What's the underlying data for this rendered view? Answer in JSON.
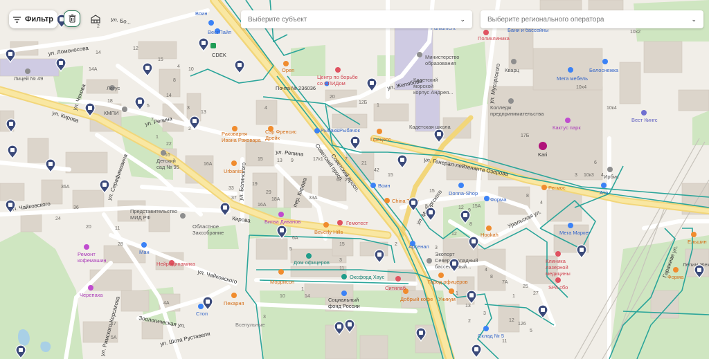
{
  "toolbar": {
    "filter_label": "Фильтр",
    "filter_icon": "filter-lines-icon",
    "trash_icon": "trash-icon",
    "stack_icon": "building-icon"
  },
  "selects": {
    "subject_placeholder": "Выберите субъект",
    "operator_placeholder": "Выберите регионального оператора"
  },
  "colors": {
    "accent": "#2e7d5b",
    "route_teal": "#26a69a",
    "main_road": "#f4d66b",
    "marker": "#3b4a7a",
    "park": "#cfe8c2",
    "building": "#dcd6cc",
    "water": "#b3d4e6"
  },
  "map": {
    "streets": [
      {
        "id": "street-kirova",
        "text": "ул. Кирова"
      },
      {
        "id": "street-kirova-2",
        "text": "Кирова"
      },
      {
        "id": "street-chaikovskogo",
        "text": "ул. Чайковского"
      },
      {
        "id": "street-chaikovskogo-2",
        "text": "ул. Чайковского"
      },
      {
        "id": "street-repina",
        "text": "ул. Репина"
      },
      {
        "id": "street-repina-2",
        "text": "ул. Репина"
      },
      {
        "id": "street-sovetsky",
        "text": "Советский просп."
      },
      {
        "id": "street-sovetsky-2",
        "text": "Советский просп."
      },
      {
        "id": "street-ozerova",
        "text": "ул. Генерал-лейтенанта Озерова"
      },
      {
        "id": "street-zhelyabova",
        "text": "ул. Желябова"
      },
      {
        "id": "street-musorgskogo",
        "text": "ул. Мусоргского"
      },
      {
        "id": "street-musorgskogo-2",
        "text": "ул. Мусоргского"
      },
      {
        "id": "street-uralskaya",
        "text": "Уральская ул."
      },
      {
        "id": "street-garazhnaya",
        "text": "Гаражная ул."
      },
      {
        "id": "street-zoologicheskaya",
        "text": "Зоологическая ул."
      },
      {
        "id": "street-rimskogo",
        "text": "ул. Римского-Корсакова"
      },
      {
        "id": "street-serafimovicha",
        "text": "ул. Серафимовича"
      },
      {
        "id": "street-shota",
        "text": "ул. Шота Руставели"
      },
      {
        "id": "street-chekhova",
        "text": "ул. Чехова"
      },
      {
        "id": "street-bolnaya",
        "text": "ул. Бо..."
      },
      {
        "id": "street-kirova-per",
        "text": "пер. Кирова"
      },
      {
        "id": "street-belinskogo",
        "text": "ул. Белинского"
      },
      {
        "id": "street-lomonosova",
        "text": "ул. Ломоносова"
      }
    ],
    "pois": [
      {
        "id": "poi-voin-top",
        "text": "Воин"
      },
      {
        "id": "poi-vestpayp",
        "text": "ВестПайп"
      },
      {
        "id": "poi-cdek",
        "text": "CDEK"
      },
      {
        "id": "poi-open",
        "text": "Open"
      },
      {
        "id": "poi-aids",
        "text": "Центр по борьбе\nсо СПИДом"
      },
      {
        "id": "poi-pochta",
        "text": "Почта № 236036"
      },
      {
        "id": "poi-kadet-korpus",
        "text": "Кадетский\nморской\nкорпус Андрея..."
      },
      {
        "id": "poi-ministry",
        "text": "Министерство\nобразования"
      },
      {
        "id": "poi-poliklinika",
        "text": "Поликлиника"
      },
      {
        "id": "poi-bani",
        "text": "Бани и бассейны"
      },
      {
        "id": "poi-parliament",
        "text": "Parliament"
      },
      {
        "id": "poi-kvarts",
        "text": "Кварц"
      },
      {
        "id": "poi-mega-mebel",
        "text": "Мега мебель"
      },
      {
        "id": "poi-belonezhka",
        "text": "Белоснежка"
      },
      {
        "id": "poi-college",
        "text": "Колледж\nпредпринимательства"
      },
      {
        "id": "poi-kadet-school",
        "text": "Кадетская школа"
      },
      {
        "id": "poi-kaktus",
        "text": "Кактус парк"
      },
      {
        "id": "poi-vest-kings",
        "text": "Вест Кингс"
      },
      {
        "id": "poi-kari",
        "text": "Kari"
      },
      {
        "id": "poi-irbis",
        "text": "Ирбис"
      },
      {
        "id": "poi-liceum",
        "text": "Лицей № 49"
      },
      {
        "id": "poi-legus",
        "text": "Легус"
      },
      {
        "id": "poi-kmpi",
        "text": "КМПИ"
      },
      {
        "id": "poi-rakovarnya",
        "text": "Раковарня\nИвана Раковара"
      },
      {
        "id": "poi-sir-francis",
        "text": "Сэр Френсис\nДрейк"
      },
      {
        "id": "poi-rybak",
        "text": "Рыбак&Рыбачок"
      },
      {
        "id": "poi-process",
        "text": "Процесс"
      },
      {
        "id": "poi-kindergarten",
        "text": "Детский\nсад № 95"
      },
      {
        "id": "poi-urbanist",
        "text": "Urbanist"
      },
      {
        "id": "poi-voin-mid",
        "text": "Воин"
      },
      {
        "id": "poi-china-town",
        "text": "China Town"
      },
      {
        "id": "poi-donna-shop",
        "text": "Donna-Shop"
      },
      {
        "id": "poi-forma-mid",
        "text": "Форма"
      },
      {
        "id": "poi-regmos",
        "text": "Регмос"
      },
      {
        "id": "poi-ato",
        "text": "Ато"
      },
      {
        "id": "poi-predstavitelstvo",
        "text": "Представительство\nМИД РФ"
      },
      {
        "id": "poi-zaksobranie",
        "text": "Областное\nЗаксобрание"
      },
      {
        "id": "poi-bitva",
        "text": "Битва Диванов"
      },
      {
        "id": "poi-gemotest",
        "text": "Гемотест"
      },
      {
        "id": "poi-beverly",
        "text": "Beverly Hills"
      },
      {
        "id": "poi-remont-kofe",
        "text": "Ремонт\nкофемашин"
      },
      {
        "id": "poi-man",
        "text": "Ман"
      },
      {
        "id": "poi-neirodinamika",
        "text": "Нейродинамика"
      },
      {
        "id": "poi-dom-oficerov",
        "text": "Дом офицеров"
      },
      {
        "id": "poi-ecoport",
        "text": "Экопорт\nСеверо-западный\nбассейновый..."
      },
      {
        "id": "poi-arsenal",
        "text": "Арсенал"
      },
      {
        "id": "poi-hookah",
        "text": "Hookah"
      },
      {
        "id": "poi-mega-market",
        "text": "Мега Маркет"
      },
      {
        "id": "poi-clinic",
        "text": "Клиника\nлазерной\nмедицины"
      },
      {
        "id": "poi-spa",
        "text": "SPA сбо"
      },
      {
        "id": "poi-elshin",
        "text": "Ельшин"
      },
      {
        "id": "poi-lepim",
        "text": "Лепим Жеж"
      },
      {
        "id": "poi-forma-right",
        "text": "Форма"
      },
      {
        "id": "poi-morrison",
        "text": "Моррисон"
      },
      {
        "id": "poi-oxford",
        "text": "Оксфорд Хаус"
      },
      {
        "id": "poi-sitilab",
        "text": "Ситилаб"
      },
      {
        "id": "poi-gorod-oficerov",
        "text": "Город офицеров"
      },
      {
        "id": "poi-dobry-kofe",
        "text": "Добрый кофе"
      },
      {
        "id": "poi-unikum",
        "text": "Уникум"
      },
      {
        "id": "poi-cherepakha",
        "text": "Черепаха"
      },
      {
        "id": "poi-pekarnya",
        "text": "Пекарня"
      },
      {
        "id": "poi-soc-fund",
        "text": "Социальный\nфонд России"
      },
      {
        "id": "poi-stop",
        "text": "Стоп"
      },
      {
        "id": "poi-sklad",
        "text": "Склад № 5"
      },
      {
        "id": "poi-vsepulnye",
        "text": "Всепульные"
      }
    ],
    "house_numbers": [
      {
        "id": "hn-1",
        "text": "2"
      },
      {
        "id": "hn-2",
        "text": "14"
      },
      {
        "id": "hn-3",
        "text": "12"
      },
      {
        "id": "hn-4",
        "text": "15"
      },
      {
        "id": "hn-5",
        "text": "4"
      },
      {
        "id": "hn-6",
        "text": "10"
      },
      {
        "id": "hn-7",
        "text": "14А"
      },
      {
        "id": "hn-8",
        "text": "8"
      },
      {
        "id": "hn-9",
        "text": "18"
      },
      {
        "id": "hn-10",
        "text": "14"
      },
      {
        "id": "hn-11",
        "text": "5"
      },
      {
        "id": "hn-12",
        "text": "3"
      },
      {
        "id": "hn-13",
        "text": "2"
      },
      {
        "id": "hn-14",
        "text": "7"
      },
      {
        "id": "hn-15",
        "text": "13"
      },
      {
        "id": "hn-16",
        "text": "22"
      },
      {
        "id": "hn-17",
        "text": "16"
      },
      {
        "id": "hn-18",
        "text": "1"
      },
      {
        "id": "hn-19",
        "text": "17Б"
      },
      {
        "id": "hn-20",
        "text": "10х4"
      },
      {
        "id": "hn-21",
        "text": "10к4"
      },
      {
        "id": "hn-22",
        "text": "10x2"
      },
      {
        "id": "hn-23",
        "text": "10к3"
      },
      {
        "id": "hn-24",
        "text": "6"
      },
      {
        "id": "hn-25",
        "text": "16А"
      },
      {
        "id": "hn-26",
        "text": "36А"
      },
      {
        "id": "hn-27",
        "text": "36"
      },
      {
        "id": "hn-28",
        "text": "24"
      },
      {
        "id": "hn-29",
        "text": "20"
      },
      {
        "id": "hn-30",
        "text": "11"
      },
      {
        "id": "hn-31",
        "text": "28"
      },
      {
        "id": "hn-32",
        "text": "4А"
      },
      {
        "id": "hn-33",
        "text": "5А"
      },
      {
        "id": "hn-34",
        "text": "17"
      },
      {
        "id": "hn-35",
        "text": "33"
      },
      {
        "id": "hn-36",
        "text": "37"
      },
      {
        "id": "hn-37",
        "text": "18А"
      },
      {
        "id": "hn-38",
        "text": "16А"
      },
      {
        "id": "hn-39",
        "text": "12Б"
      },
      {
        "id": "hn-40",
        "text": "20"
      },
      {
        "id": "hn-41",
        "text": "4"
      },
      {
        "id": "hn-42",
        "text": "17к1"
      },
      {
        "id": "hn-43",
        "text": "15"
      },
      {
        "id": "hn-44",
        "text": "13"
      },
      {
        "id": "hn-45",
        "text": "9"
      },
      {
        "id": "hn-46",
        "text": "19"
      },
      {
        "id": "hn-47",
        "text": "29"
      },
      {
        "id": "hn-48",
        "text": "1"
      },
      {
        "id": "hn-49",
        "text": "33А"
      },
      {
        "id": "hn-50",
        "text": "6"
      },
      {
        "id": "hn-51",
        "text": "7"
      },
      {
        "id": "hn-52",
        "text": "27"
      },
      {
        "id": "hn-53",
        "text": "15"
      },
      {
        "id": "hn-54",
        "text": "15"
      },
      {
        "id": "hn-55",
        "text": "3"
      },
      {
        "id": "hn-56",
        "text": "11"
      },
      {
        "id": "hn-57",
        "text": "5"
      },
      {
        "id": "hn-58",
        "text": "6А"
      },
      {
        "id": "hn-59",
        "text": "21"
      },
      {
        "id": "hn-60",
        "text": "42"
      },
      {
        "id": "hn-61",
        "text": "15"
      },
      {
        "id": "hn-62",
        "text": "5"
      },
      {
        "id": "hn-63",
        "text": "12"
      },
      {
        "id": "hn-64",
        "text": "9"
      },
      {
        "id": "hn-65",
        "text": "8"
      },
      {
        "id": "hn-66",
        "text": "12"
      },
      {
        "id": "hn-67",
        "text": "3"
      },
      {
        "id": "hn-68",
        "text": "4"
      },
      {
        "id": "hn-69",
        "text": "8"
      },
      {
        "id": "hn-70",
        "text": "1"
      },
      {
        "id": "hn-71",
        "text": "13"
      },
      {
        "id": "hn-72",
        "text": "7А"
      },
      {
        "id": "hn-73",
        "text": "1"
      },
      {
        "id": "hn-74",
        "text": "25"
      },
      {
        "id": "hn-75",
        "text": "27"
      },
      {
        "id": "hn-76",
        "text": "2"
      },
      {
        "id": "hn-77",
        "text": "3"
      },
      {
        "id": "hn-78",
        "text": "11"
      },
      {
        "id": "hn-79",
        "text": "12"
      },
      {
        "id": "hn-80",
        "text": "126"
      },
      {
        "id": "hn-81",
        "text": "5"
      },
      {
        "id": "hn-82",
        "text": "4"
      },
      {
        "id": "hn-83",
        "text": "8"
      },
      {
        "id": "hn-84",
        "text": "3"
      },
      {
        "id": "hn-85",
        "text": "4"
      },
      {
        "id": "hn-86",
        "text": "3"
      },
      {
        "id": "hn-87",
        "text": "1"
      },
      {
        "id": "hn-88",
        "text": "14"
      },
      {
        "id": "hn-89",
        "text": "10"
      },
      {
        "id": "hn-90",
        "text": "2"
      },
      {
        "id": "hn-91",
        "text": "8"
      },
      {
        "id": "hn-92",
        "text": "15А"
      }
    ]
  }
}
